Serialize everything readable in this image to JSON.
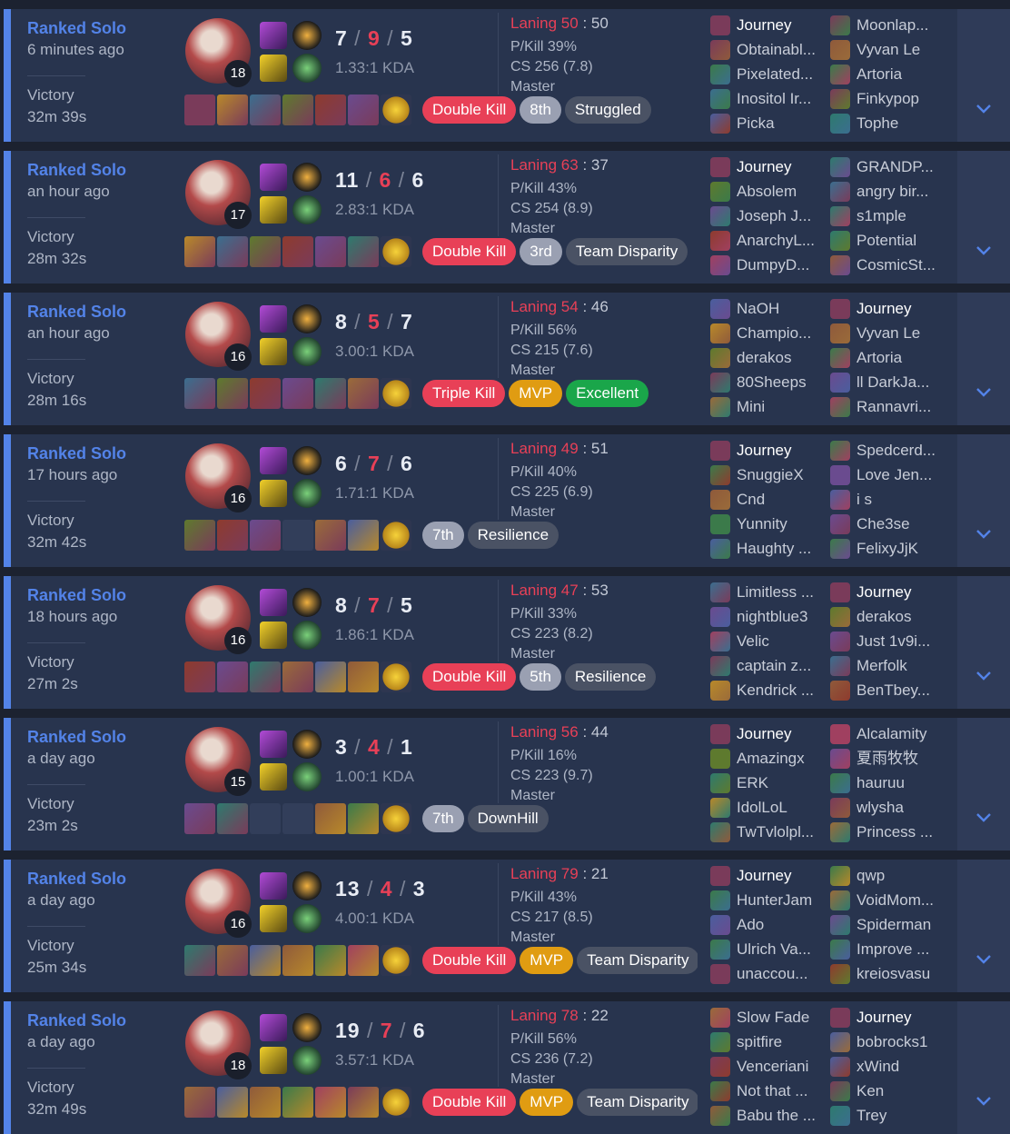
{
  "theme": {
    "accent": "#5383e8",
    "death": "#e84057",
    "card_bg": "#28344e"
  },
  "matches": [
    {
      "queue": "Ranked Solo",
      "time_ago": "6 minutes ago",
      "result": "Victory",
      "duration": "32m 39s",
      "champion_icon": "katarina-portrait-icon",
      "level": "18",
      "spells": [
        "flash-icon",
        "ignite-icon"
      ],
      "runes": [
        "electrocute-icon",
        "resolve-icon"
      ],
      "kills": "7",
      "deaths": "9",
      "assists": "5",
      "kda_ratio": "1.33:1 KDA",
      "items": [
        "item-icon",
        "item-icon",
        "item-icon",
        "item-icon",
        "item-icon",
        "item-icon",
        "trinket-icon"
      ],
      "badges": [
        {
          "text": "Double Kill",
          "style": "red"
        },
        {
          "text": "8th",
          "style": "gray"
        },
        {
          "text": "Struggled",
          "style": "dark"
        }
      ],
      "laning_label": "Laning",
      "laning_mine": "50",
      "laning_theirs": "50",
      "pkill": "P/Kill 39%",
      "cs": "CS 256 (7.8)",
      "tier": "Master",
      "team_left": [
        {
          "name": "Journey",
          "me": true
        },
        {
          "name": "Obtainabl..."
        },
        {
          "name": "Pixelated..."
        },
        {
          "name": "Inositol Ir..."
        },
        {
          "name": "Picka"
        }
      ],
      "team_right": [
        {
          "name": "Moonlap..."
        },
        {
          "name": "Vyvan Le"
        },
        {
          "name": "Artoria"
        },
        {
          "name": "Finkypop"
        },
        {
          "name": "Tophe"
        }
      ]
    },
    {
      "queue": "Ranked Solo",
      "time_ago": "an hour ago",
      "result": "Victory",
      "duration": "28m 32s",
      "champion_icon": "katarina-portrait-icon",
      "level": "17",
      "spells": [
        "flash-icon",
        "ignite-icon"
      ],
      "runes": [
        "conqueror-icon",
        "resolve-icon"
      ],
      "kills": "11",
      "deaths": "6",
      "assists": "6",
      "kda_ratio": "2.83:1 KDA",
      "items": [
        "item-icon",
        "item-icon",
        "item-icon",
        "item-icon",
        "item-icon",
        "item-icon",
        "trinket-icon"
      ],
      "badges": [
        {
          "text": "Double Kill",
          "style": "red"
        },
        {
          "text": "3rd",
          "style": "gray"
        },
        {
          "text": "Team Disparity",
          "style": "dark"
        }
      ],
      "laning_label": "Laning",
      "laning_mine": "63",
      "laning_theirs": "37",
      "pkill": "P/Kill 43%",
      "cs": "CS 254 (8.9)",
      "tier": "Master",
      "team_left": [
        {
          "name": "Journey",
          "me": true
        },
        {
          "name": "Absolem"
        },
        {
          "name": "Joseph J..."
        },
        {
          "name": "AnarchyL..."
        },
        {
          "name": "DumpyD..."
        }
      ],
      "team_right": [
        {
          "name": "GRANDP..."
        },
        {
          "name": "angry bir..."
        },
        {
          "name": "s1mple"
        },
        {
          "name": "Potential"
        },
        {
          "name": "CosmicSt..."
        }
      ]
    },
    {
      "queue": "Ranked Solo",
      "time_ago": "an hour ago",
      "result": "Victory",
      "duration": "28m 16s",
      "champion_icon": "vayne-portrait-icon",
      "level": "16",
      "spells": [
        "ghost-icon",
        "ignite-icon"
      ],
      "runes": [
        "dark-harvest-icon",
        "sorcery-icon"
      ],
      "kills": "8",
      "deaths": "5",
      "assists": "7",
      "kda_ratio": "3.00:1 KDA",
      "items": [
        "item-icon",
        "item-icon",
        "item-icon",
        "item-icon",
        "item-icon",
        "item-icon",
        "trinket-icon"
      ],
      "badges": [
        {
          "text": "Triple Kill",
          "style": "red"
        },
        {
          "text": "MVP",
          "style": "gold"
        },
        {
          "text": "Excellent",
          "style": "green"
        }
      ],
      "laning_label": "Laning",
      "laning_mine": "54",
      "laning_theirs": "46",
      "pkill": "P/Kill 56%",
      "cs": "CS 215 (7.6)",
      "tier": "Master",
      "team_left": [
        {
          "name": "NaOH"
        },
        {
          "name": "Champio..."
        },
        {
          "name": "derakos"
        },
        {
          "name": "80Sheeps"
        },
        {
          "name": "Mini"
        }
      ],
      "team_right": [
        {
          "name": "Journey",
          "me": true
        },
        {
          "name": "Vyvan Le"
        },
        {
          "name": "Artoria"
        },
        {
          "name": "ll DarkJa..."
        },
        {
          "name": "Rannavri..."
        }
      ]
    },
    {
      "queue": "Ranked Solo",
      "time_ago": "17 hours ago",
      "result": "Victory",
      "duration": "32m 42s",
      "champion_icon": "camille-portrait-icon",
      "level": "16",
      "spells": [
        "flash-icon",
        "ignite-icon"
      ],
      "runes": [
        "fleet-icon",
        "inspiration-icon"
      ],
      "kills": "6",
      "deaths": "7",
      "assists": "6",
      "kda_ratio": "1.71:1 KDA",
      "items": [
        "item-icon",
        "item-icon",
        "item-icon",
        "empty-slot",
        "item-icon",
        "item-icon",
        "trinket-icon"
      ],
      "badges": [
        {
          "text": "7th",
          "style": "gray"
        },
        {
          "text": "Resilience",
          "style": "dark"
        }
      ],
      "laning_label": "Laning",
      "laning_mine": "49",
      "laning_theirs": "51",
      "pkill": "P/Kill 40%",
      "cs": "CS 225 (6.9)",
      "tier": "Master",
      "team_left": [
        {
          "name": "Journey",
          "me": true
        },
        {
          "name": "SnuggieX"
        },
        {
          "name": "Cnd"
        },
        {
          "name": "Yunnity"
        },
        {
          "name": "Haughty ..."
        }
      ],
      "team_right": [
        {
          "name": "Spedcerd..."
        },
        {
          "name": "Love Jen..."
        },
        {
          "name": "i s"
        },
        {
          "name": "Che3se"
        },
        {
          "name": "FelixyJjK"
        }
      ]
    },
    {
      "queue": "Ranked Solo",
      "time_ago": "18 hours ago",
      "result": "Victory",
      "duration": "27m 2s",
      "champion_icon": "katarina-portrait-icon",
      "level": "16",
      "spells": [
        "flash-icon",
        "ignite-icon"
      ],
      "runes": [
        "conqueror-icon",
        "resolve-icon"
      ],
      "kills": "8",
      "deaths": "7",
      "assists": "5",
      "kda_ratio": "1.86:1 KDA",
      "items": [
        "item-icon",
        "item-icon",
        "item-icon",
        "item-icon",
        "item-icon",
        "item-icon",
        "trinket-icon"
      ],
      "badges": [
        {
          "text": "Double Kill",
          "style": "red"
        },
        {
          "text": "5th",
          "style": "gray"
        },
        {
          "text": "Resilience",
          "style": "dark"
        }
      ],
      "laning_label": "Laning",
      "laning_mine": "47",
      "laning_theirs": "53",
      "pkill": "P/Kill 33%",
      "cs": "CS 223 (8.2)",
      "tier": "Master",
      "team_left": [
        {
          "name": "Limitless ..."
        },
        {
          "name": "nightblue3"
        },
        {
          "name": "Velic"
        },
        {
          "name": "captain z..."
        },
        {
          "name": "Kendrick ..."
        }
      ],
      "team_right": [
        {
          "name": "Journey",
          "me": true
        },
        {
          "name": "derakos"
        },
        {
          "name": "Just 1v9i..."
        },
        {
          "name": "Merfolk"
        },
        {
          "name": "BenTbey..."
        }
      ]
    },
    {
      "queue": "Ranked Solo",
      "time_ago": "a day ago",
      "result": "Victory",
      "duration": "23m 2s",
      "champion_icon": "irelia-portrait-icon",
      "level": "15",
      "spells": [
        "flash-icon",
        "ignite-icon"
      ],
      "runes": [
        "conqueror-icon",
        "inspiration-icon"
      ],
      "kills": "3",
      "deaths": "4",
      "assists": "1",
      "kda_ratio": "1.00:1 KDA",
      "items": [
        "item-icon",
        "item-icon",
        "empty-slot",
        "empty-slot",
        "item-icon",
        "item-icon",
        "trinket-icon"
      ],
      "badges": [
        {
          "text": "7th",
          "style": "gray"
        },
        {
          "text": "DownHill",
          "style": "dark"
        }
      ],
      "laning_label": "Laning",
      "laning_mine": "56",
      "laning_theirs": "44",
      "pkill": "P/Kill 16%",
      "cs": "CS 223 (9.7)",
      "tier": "Master",
      "team_left": [
        {
          "name": "Journey",
          "me": true
        },
        {
          "name": "Amazingx"
        },
        {
          "name": "ERK"
        },
        {
          "name": "IdolLoL"
        },
        {
          "name": "TwTvlolpl..."
        }
      ],
      "team_right": [
        {
          "name": "Alcalamity"
        },
        {
          "name": "夏雨牧牧"
        },
        {
          "name": "hauruu"
        },
        {
          "name": "wlysha"
        },
        {
          "name": "Princess ..."
        }
      ]
    },
    {
      "queue": "Ranked Solo",
      "time_ago": "a day ago",
      "result": "Victory",
      "duration": "25m 34s",
      "champion_icon": "katarina-portrait-icon",
      "level": "16",
      "spells": [
        "flash-icon",
        "ignite-icon"
      ],
      "runes": [
        "conqueror-icon",
        "resolve-icon"
      ],
      "kills": "13",
      "deaths": "4",
      "assists": "3",
      "kda_ratio": "4.00:1 KDA",
      "items": [
        "item-icon",
        "item-icon",
        "item-icon",
        "item-icon",
        "item-icon",
        "item-icon",
        "trinket-icon"
      ],
      "badges": [
        {
          "text": "Double Kill",
          "style": "red"
        },
        {
          "text": "MVP",
          "style": "gold"
        },
        {
          "text": "Team Disparity",
          "style": "dark"
        }
      ],
      "laning_label": "Laning",
      "laning_mine": "79",
      "laning_theirs": "21",
      "pkill": "P/Kill 43%",
      "cs": "CS 217 (8.5)",
      "tier": "Master",
      "team_left": [
        {
          "name": "Journey",
          "me": true
        },
        {
          "name": "HunterJam"
        },
        {
          "name": "Ado"
        },
        {
          "name": "Ulrich Va..."
        },
        {
          "name": "unaccou..."
        }
      ],
      "team_right": [
        {
          "name": "qwp"
        },
        {
          "name": "VoidMom..."
        },
        {
          "name": "Spiderman"
        },
        {
          "name": "Improve ..."
        },
        {
          "name": "kreiosvasu"
        }
      ]
    },
    {
      "queue": "Ranked Solo",
      "time_ago": "a day ago",
      "result": "Victory",
      "duration": "32m 49s",
      "champion_icon": "katarina-portrait-icon",
      "level": "18",
      "spells": [
        "flash-icon",
        "ignite-icon"
      ],
      "runes": [
        "conqueror-icon",
        "resolve-icon"
      ],
      "kills": "19",
      "deaths": "7",
      "assists": "6",
      "kda_ratio": "3.57:1 KDA",
      "items": [
        "item-icon",
        "item-icon",
        "item-icon",
        "item-icon",
        "item-icon",
        "item-icon",
        "trinket-icon"
      ],
      "badges": [
        {
          "text": "Double Kill",
          "style": "red"
        },
        {
          "text": "MVP",
          "style": "gold"
        },
        {
          "text": "Team Disparity",
          "style": "dark"
        }
      ],
      "laning_label": "Laning",
      "laning_mine": "78",
      "laning_theirs": "22",
      "pkill": "P/Kill 56%",
      "cs": "CS 236 (7.2)",
      "tier": "Master",
      "team_left": [
        {
          "name": "Slow Fade"
        },
        {
          "name": "spitfire"
        },
        {
          "name": "Venceriani"
        },
        {
          "name": "Not that ..."
        },
        {
          "name": "Babu the ..."
        }
      ],
      "team_right": [
        {
          "name": "Journey",
          "me": true
        },
        {
          "name": "bobrocks1"
        },
        {
          "name": "xWind"
        },
        {
          "name": "Ken"
        },
        {
          "name": "Trey"
        }
      ]
    }
  ]
}
